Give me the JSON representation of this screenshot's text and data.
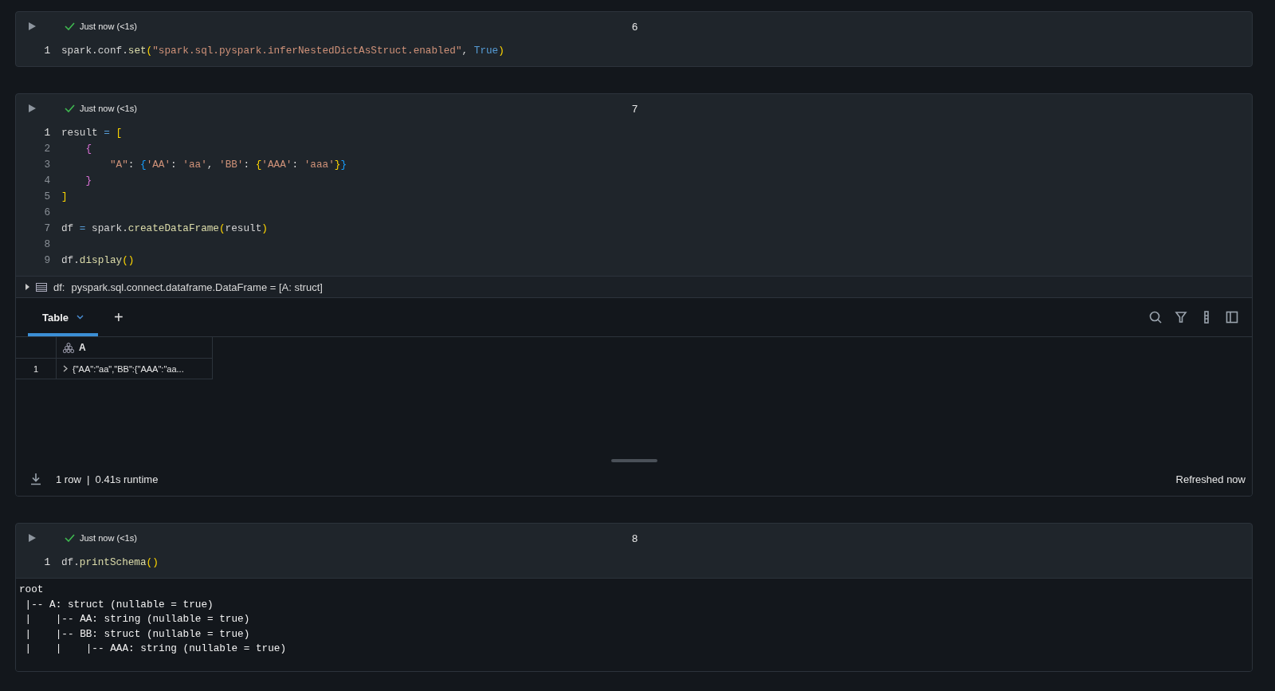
{
  "cells": [
    {
      "number": "6",
      "status": "Just now (<1s)",
      "succeeded": true,
      "lines": [
        {
          "no": "1",
          "tokens": [
            {
              "kind": "plain",
              "text": "spark.conf."
            },
            {
              "kind": "func",
              "text": "set"
            },
            {
              "kind": "bracket1",
              "text": "("
            },
            {
              "kind": "string",
              "text": "\"spark.sql.pyspark.inferNestedDictAsStruct.enabled\""
            },
            {
              "kind": "plain",
              "text": ", "
            },
            {
              "kind": "keyword",
              "text": "True"
            },
            {
              "kind": "bracket1",
              "text": ")"
            }
          ]
        }
      ]
    },
    {
      "number": "7",
      "status": "Just now (<1s)",
      "succeeded": true,
      "lines": [
        {
          "no": "1",
          "tokens": [
            {
              "kind": "plain",
              "text": "result "
            },
            {
              "kind": "op",
              "text": "= "
            },
            {
              "kind": "bracket1",
              "text": "["
            }
          ]
        },
        {
          "no": "2",
          "tokens": [
            {
              "kind": "bracket2",
              "text": "    {"
            }
          ]
        },
        {
          "no": "3",
          "tokens": [
            {
              "kind": "string",
              "text": "        \"A\""
            },
            {
              "kind": "plain",
              "text": ": "
            },
            {
              "kind": "bracket3",
              "text": "{"
            },
            {
              "kind": "string",
              "text": "'AA'"
            },
            {
              "kind": "plain",
              "text": ": "
            },
            {
              "kind": "string",
              "text": "'aa'"
            },
            {
              "kind": "plain",
              "text": ", "
            },
            {
              "kind": "string",
              "text": "'BB'"
            },
            {
              "kind": "plain",
              "text": ": "
            },
            {
              "kind": "bracket1",
              "text": "{"
            },
            {
              "kind": "string",
              "text": "'AAA'"
            },
            {
              "kind": "plain",
              "text": ": "
            },
            {
              "kind": "string",
              "text": "'aaa'"
            },
            {
              "kind": "bracket1",
              "text": "}"
            },
            {
              "kind": "bracket3",
              "text": "}"
            }
          ]
        },
        {
          "no": "4",
          "tokens": [
            {
              "kind": "bracket2",
              "text": "    }"
            }
          ]
        },
        {
          "no": "5",
          "tokens": [
            {
              "kind": "bracket1",
              "text": "]"
            }
          ]
        },
        {
          "no": "6"
        },
        {
          "no": "7",
          "tokens": [
            {
              "kind": "plain",
              "text": "df "
            },
            {
              "kind": "op",
              "text": "="
            },
            {
              "kind": "plain",
              "text": " spark."
            },
            {
              "kind": "func",
              "text": "createDataFrame"
            },
            {
              "kind": "bracket1",
              "text": "("
            },
            {
              "kind": "plain",
              "text": "result"
            },
            {
              "kind": "bracket1",
              "text": ")"
            }
          ]
        },
        {
          "no": "8"
        },
        {
          "no": "9",
          "tokens": [
            {
              "kind": "plain",
              "text": "df."
            },
            {
              "kind": "func",
              "text": "display"
            },
            {
              "kind": "bracket1",
              "text": "()"
            }
          ]
        }
      ],
      "output": {
        "kind": "dataframe",
        "variable": "df:",
        "schema": "pyspark.sql.connect.dataframe.DataFrame = [A: struct]",
        "tabs": [
          {
            "label": "Table",
            "selected": true
          }
        ],
        "add_tab": "+",
        "columns": [
          {
            "name": "A"
          }
        ],
        "rows": [
          {
            "index": "1",
            "cells": [
              "{\"AA\":\"aa\",\"BB\":{\"AAA\":\"aa..."
            ]
          }
        ],
        "summary": "1 row  |  0.41s runtime",
        "refreshed": "Refreshed now"
      }
    },
    {
      "number": "8",
      "status": "Just now (<1s)",
      "succeeded": true,
      "lines": [
        {
          "no": "1",
          "tokens": [
            {
              "kind": "plain",
              "text": "df."
            },
            {
              "kind": "func",
              "text": "printSchema"
            },
            {
              "kind": "bracket1",
              "text": "()"
            }
          ]
        }
      ],
      "output": {
        "kind": "text",
        "lines": [
          "root",
          " |-- A: struct (nullable = true)",
          " |    |-- AA: string (nullable = true)",
          " |    |-- BB: struct (nullable = true)",
          " |    |    |-- AAA: string (nullable = true)"
        ]
      }
    }
  ]
}
